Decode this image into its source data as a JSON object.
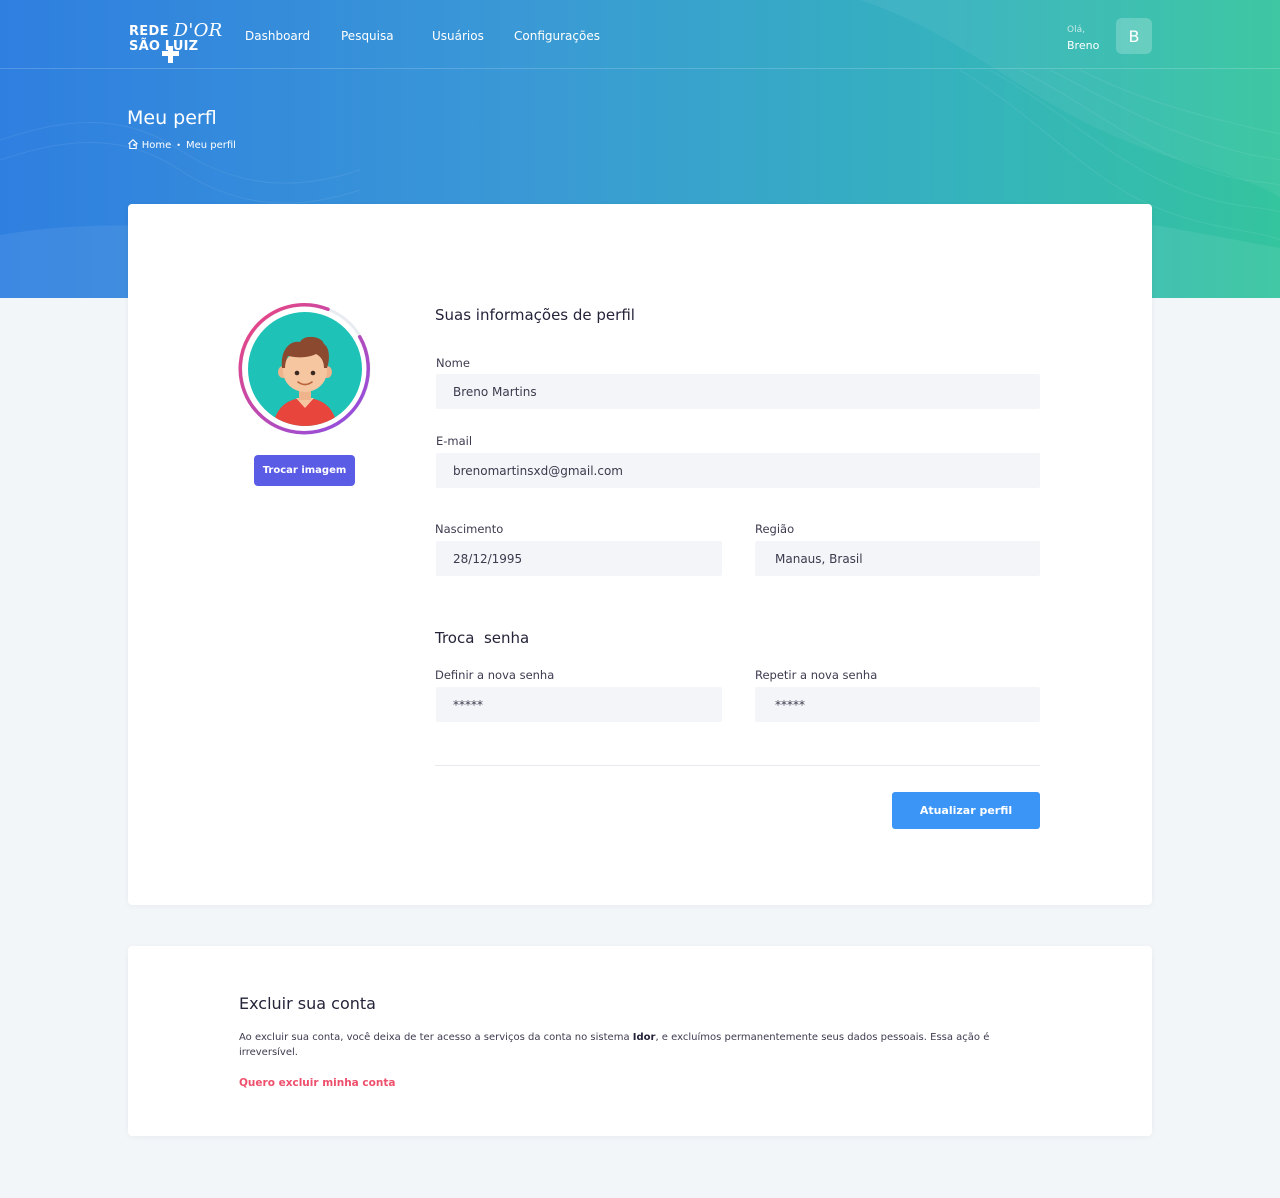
{
  "brand": {
    "line1": "REDE",
    "line1_script": "D'OR",
    "line2": "SÃO LUIZ"
  },
  "nav": [
    {
      "label": "Dashboard"
    },
    {
      "label": "Pesquisa"
    },
    {
      "label": "Usuários"
    },
    {
      "label": "Configurações"
    }
  ],
  "user": {
    "greeting": "Olá,",
    "name": "Breno",
    "initial": "B"
  },
  "header": {
    "title": "Meu perfl",
    "breadcrumb": {
      "home": "Home",
      "current": "Meu perfil"
    }
  },
  "profile": {
    "change_image_label": "Trocar imagem",
    "section_title": "Suas informações de perfil",
    "fields": {
      "name": {
        "label": "Nome",
        "value": "Breno Martins"
      },
      "email": {
        "label": "E-mail",
        "value": "brenomartinsxd@gmail.com"
      },
      "birth": {
        "label": "Nascimento",
        "value": "28/12/1995"
      },
      "region": {
        "label": "Região",
        "value": "Manaus, Brasil"
      }
    }
  },
  "password": {
    "section_title": "Troca  senha",
    "new": {
      "label": "Definir a nova senha",
      "value": "*****"
    },
    "repeat": {
      "label": "Repetir a nova senha",
      "value": "*****"
    }
  },
  "update_button": "Atualizar perfil",
  "delete_account": {
    "title": "Excluir sua conta",
    "text_before": "Ao excluir sua conta, você deixa de ter acesso a serviços da conta no sistema ",
    "text_bold": "Idor",
    "text_after": ", e excluímos permanentemente seus dados pessoais. Essa ação é irreversível.",
    "link": "Quero excluir minha conta"
  },
  "colors": {
    "hero_start": "#2f7fe0",
    "hero_end": "#34c49e",
    "primary_button": "#3b95f7",
    "secondary_button": "#5b5ce6",
    "danger": "#ee4f6c",
    "avatar_bg": "#1fc2b6"
  }
}
